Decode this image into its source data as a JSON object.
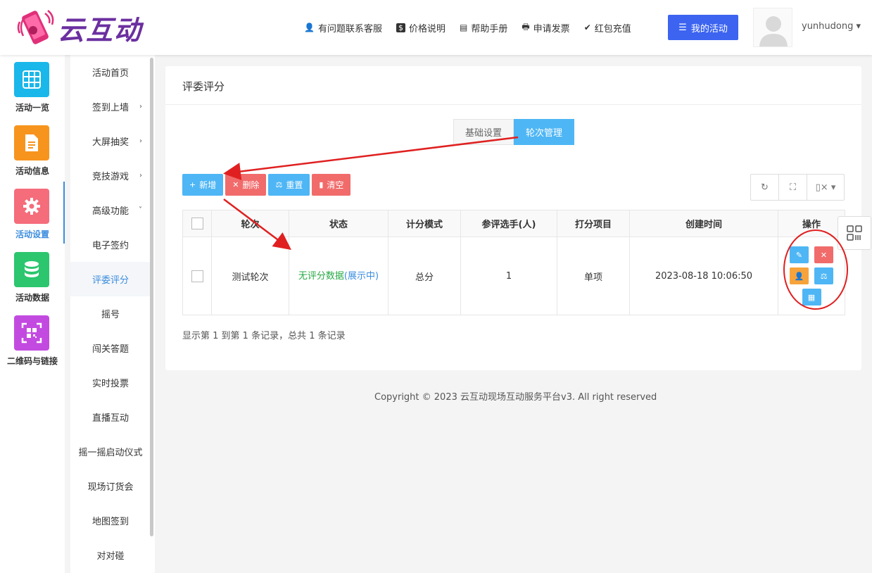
{
  "brand": {
    "name": "云互动"
  },
  "header": {
    "nav": [
      {
        "icon": "user-plus-icon",
        "glyph": "👤",
        "label": "有问题联系客服"
      },
      {
        "icon": "dollar-icon",
        "glyph": "$",
        "label": "价格说明"
      },
      {
        "icon": "book-icon",
        "glyph": "▤",
        "label": "帮助手册"
      },
      {
        "icon": "printer-icon",
        "glyph": "🖶",
        "label": "申请发票"
      },
      {
        "icon": "check-shield-icon",
        "glyph": "✔",
        "label": "红包充值"
      }
    ],
    "my_activity": "我的活动",
    "username": "yunhudong",
    "accent": "#3c64f0"
  },
  "icon_sidebar": [
    {
      "label": "活动一览",
      "icon": "grid-icon",
      "color": "#1ab7ea"
    },
    {
      "label": "活动信息",
      "icon": "document-icon",
      "color": "#f7941d"
    },
    {
      "label": "活动设置",
      "icon": "gear-icon",
      "color": "#f56c7b",
      "active": true
    },
    {
      "label": "活动数据",
      "icon": "database-icon",
      "color": "#2bc66e"
    },
    {
      "label": "二维码与链接",
      "icon": "qrcode-icon",
      "color": "#c34ae0"
    }
  ],
  "sub_sidebar": [
    {
      "label": "活动首页"
    },
    {
      "label": "签到上墙",
      "chevron": "›"
    },
    {
      "label": "大屏抽奖",
      "chevron": "›"
    },
    {
      "label": "竞技游戏",
      "chevron": "›"
    },
    {
      "label": "高级功能",
      "chevron": "˅"
    },
    {
      "label": "电子签约"
    },
    {
      "label": "评委评分",
      "active": true
    },
    {
      "label": "摇号"
    },
    {
      "label": "闯关答题"
    },
    {
      "label": "实时投票"
    },
    {
      "label": "直播互动"
    },
    {
      "label": "摇一摇启动仪式"
    },
    {
      "label": "现场订货会"
    },
    {
      "label": "地图签到"
    },
    {
      "label": "对对碰"
    }
  ],
  "card": {
    "title": "评委评分",
    "tabs": [
      "基础设置",
      "轮次管理"
    ],
    "toolbar": [
      {
        "icon": "plus-icon",
        "glyph": "+",
        "label": "新增",
        "color": "blue"
      },
      {
        "icon": "times-icon",
        "glyph": "✕",
        "label": "删除",
        "color": "red"
      },
      {
        "icon": "gavel-icon",
        "glyph": "⚖",
        "label": "重置",
        "color": "blue"
      },
      {
        "icon": "trash-icon",
        "glyph": "▮",
        "label": "清空",
        "color": "red"
      }
    ],
    "right_tools": [
      {
        "icon": "refresh-icon",
        "glyph": "↻"
      },
      {
        "icon": "fullscreen-icon",
        "glyph": "⛶"
      },
      {
        "icon": "columns-icon",
        "glyph": "▯× ▾"
      }
    ],
    "table": {
      "headers": [
        "轮次",
        "状态",
        "计分模式",
        "参评选手(人)",
        "打分项目",
        "创建时间",
        "操作"
      ],
      "rows": [
        {
          "round": "测试轮次",
          "status_main": "无评分数据",
          "status_sub": "(展示中)",
          "mode": "总分",
          "players": "1",
          "item": "单项",
          "created": "2023-08-18 10:06:50"
        }
      ]
    },
    "records": "显示第 1 到第 1 条记录，总共 1 条记录"
  },
  "footer": {
    "copyright": "Copyright © 2023 云互动现场互动服务平台v3. All right reserved"
  }
}
